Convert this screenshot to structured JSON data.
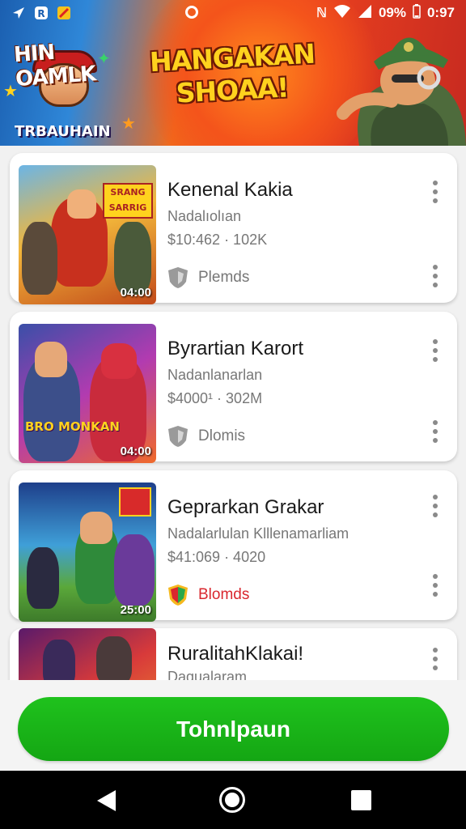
{
  "status_bar": {
    "battery": "09%",
    "time": "0:97"
  },
  "banner": {
    "logo_text": "HIN OAMLK",
    "logo_subtext": "TRBAUHAIN",
    "headline": "HANGAKAN SHOAA!"
  },
  "items": [
    {
      "title": "Kenenal Kakia",
      "subtitle": "Nadalıolıan",
      "meta": "$10:462 · 102K",
      "badge": "Plemds",
      "duration": "04:00",
      "thumb_text": "SRANG SARRIG",
      "badge_color": "#777777"
    },
    {
      "title": "Byrartian Karort",
      "subtitle": "Nadanlanarlan",
      "meta": "$4000¹ · 302M",
      "badge": "Dlomis",
      "duration": "04:00",
      "thumb_text": "BRO MONKAN",
      "badge_color": "#777777"
    },
    {
      "title": "Geprarkan Grakar",
      "subtitle": "Nadalarlulan Klllenamarliam",
      "meta": "$41:069 · 4020",
      "badge": "Blomds",
      "duration": "25:00",
      "thumb_text": "",
      "badge_color": "#d9272e"
    },
    {
      "title": "RuralitahKlakai!",
      "subtitle": "Daqualaram",
      "meta": "",
      "badge": "",
      "duration": "",
      "thumb_text": "",
      "badge_color": "#777777"
    }
  ],
  "cta": {
    "label": "Tohnlpaun",
    "color": "#1cb81a"
  },
  "icons": {
    "item_menu": "more-vert-icon",
    "badge": "shield-icon",
    "nav_back": "back-triangle-icon",
    "nav_home": "home-circle-icon",
    "nav_recent": "recent-square-icon"
  }
}
